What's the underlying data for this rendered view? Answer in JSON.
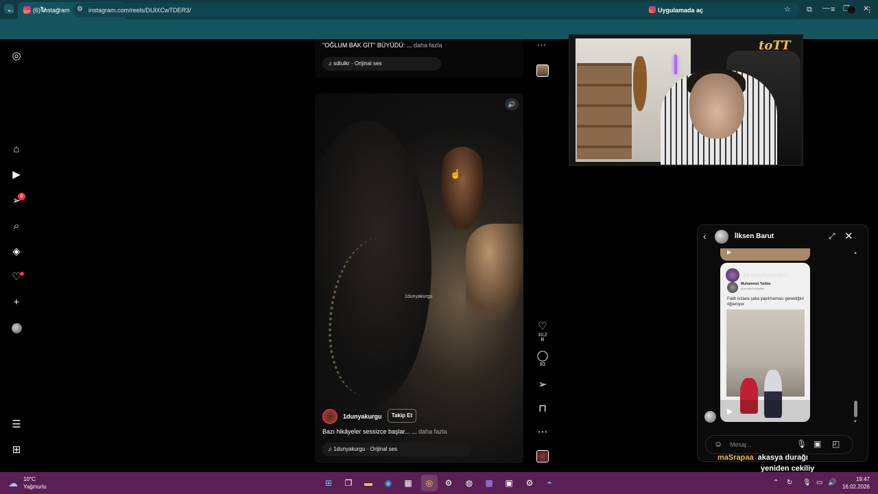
{
  "browser": {
    "tab_title": "(6) Instagram",
    "url": "instagram.com/reels/DUlXCwTDER3/",
    "open_in_app": "Uygulamada aç",
    "icons": {
      "tab_menu": "chevron-down-icon",
      "mute": "speaker-icon",
      "close": "close-icon",
      "new_tab": "plus-icon",
      "back": "arrow-left-icon",
      "forward": "arrow-right-icon",
      "reload": "reload-icon",
      "home": "home-icon"
    }
  },
  "sidebar": {
    "notification_count": "6",
    "items": [
      "instagram-logo",
      "home",
      "reels",
      "messages",
      "search",
      "explore",
      "notifications",
      "create",
      "profile",
      "more",
      "also-from-meta"
    ]
  },
  "prev_reel": {
    "caption": "\"OĞLUM BAK GİT\" BÜYÜDÜ: ...",
    "more": "daha fazla",
    "audio": "♫ sdtulkr · Orijinal ses"
  },
  "reel": {
    "watermark": "1dunyakurgu",
    "account": "1dunyakurgu",
    "follow_label": "Takip Et",
    "caption": "Bazı hikâyeler sessizce başlar... ...",
    "more": "daha fazla",
    "audio": "♫ 1dunyakurgu · Orijinal ses",
    "likes": "10,2 B",
    "comments": "83"
  },
  "overlay": {
    "logo": "toTT"
  },
  "dm": {
    "contact_name": "İlksen Barut",
    "card_handle": "kiravbabgezilesi",
    "card_author": "Muhammet Twitter",
    "card_author_handle": "@muhammettwitter",
    "card_caption": "Fatih kızlara şaka yapılmaması gerektiğini öğreniyor",
    "placeholder": "Mesaj..."
  },
  "chat": {
    "user": "maSrapaa",
    "message_line1": "akasya durağı",
    "message_line2": "yeniden cekiliy"
  },
  "taskbar": {
    "temperature": "10°C",
    "condition": "Yağmurlu",
    "time": "19:47",
    "date": "16.02.2026"
  },
  "colors": {
    "tab_bar": "#0f3b45",
    "address_bar": "#14545f",
    "taskbar": "#5a1f55",
    "notification_red": "#ff3040",
    "chat_user": "#f2c230"
  }
}
